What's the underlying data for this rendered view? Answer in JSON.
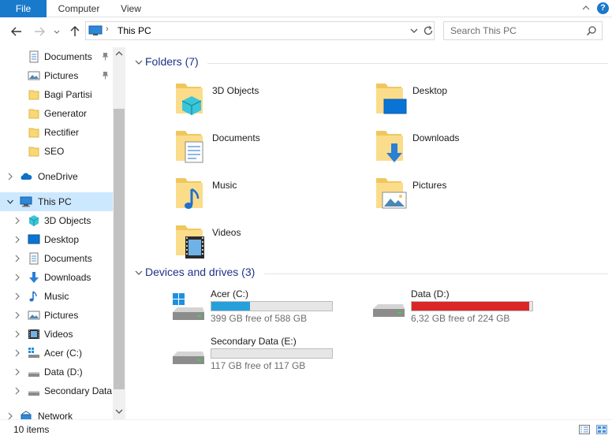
{
  "ribbon": {
    "tabs": [
      "File",
      "Computer",
      "View"
    ],
    "help": "?"
  },
  "address": {
    "separator": "›",
    "path": "This PC"
  },
  "search": {
    "placeholder": "Search This PC"
  },
  "sidebar": {
    "items": [
      {
        "label": "Documents",
        "icon": "documents-icon",
        "pinned": true
      },
      {
        "label": "Pictures",
        "icon": "pictures-icon",
        "pinned": true
      },
      {
        "label": "Bagi Partisi",
        "icon": "folder-icon"
      },
      {
        "label": "Generator",
        "icon": "folder-icon"
      },
      {
        "label": "Rectifier",
        "icon": "folder-icon"
      },
      {
        "label": "SEO",
        "icon": "folder-icon"
      },
      {
        "label": "OneDrive",
        "icon": "onedrive-icon"
      },
      {
        "label": "This PC",
        "icon": "this-pc-icon",
        "selected": true
      },
      {
        "label": "3D Objects",
        "icon": "3d-objects-icon"
      },
      {
        "label": "Desktop",
        "icon": "desktop-icon"
      },
      {
        "label": "Documents",
        "icon": "documents-icon"
      },
      {
        "label": "Downloads",
        "icon": "downloads-icon"
      },
      {
        "label": "Music",
        "icon": "music-icon"
      },
      {
        "label": "Pictures",
        "icon": "pictures-icon"
      },
      {
        "label": "Videos",
        "icon": "videos-icon"
      },
      {
        "label": "Acer (C:)",
        "icon": "system-drive-icon"
      },
      {
        "label": "Data  (D:)",
        "icon": "drive-icon"
      },
      {
        "label": "Secondary Data",
        "icon": "drive-icon"
      },
      {
        "label": "Network",
        "icon": "network-icon"
      }
    ]
  },
  "folders": {
    "heading": "Folders (7)",
    "items": [
      {
        "label": "3D Objects",
        "icon": "3d-objects-folder-icon"
      },
      {
        "label": "Desktop",
        "icon": "desktop-folder-icon"
      },
      {
        "label": "Documents",
        "icon": "documents-folder-icon"
      },
      {
        "label": "Downloads",
        "icon": "downloads-folder-icon"
      },
      {
        "label": "Music",
        "icon": "music-folder-icon"
      },
      {
        "label": "Pictures",
        "icon": "pictures-folder-icon"
      },
      {
        "label": "Videos",
        "icon": "videos-folder-icon"
      }
    ]
  },
  "devices": {
    "heading": "Devices and drives (3)",
    "items": [
      {
        "name": "Acer (C:)",
        "free": "399 GB free of 588 GB",
        "used_fraction": 0.321,
        "bar_color": "#26a0da",
        "icon": "system-drive-icon"
      },
      {
        "name": "Data  (D:)",
        "free": "6,32 GB free of 224 GB",
        "used_fraction": 0.972,
        "bar_color": "#da2626",
        "icon": "drive-icon"
      },
      {
        "name": "Secondary Data (E:)",
        "free": "117 GB free of 117 GB",
        "used_fraction": 0.0,
        "bar_color": "#26a0da",
        "icon": "drive-icon"
      }
    ]
  },
  "status": {
    "count": "10 items"
  },
  "colors": {
    "accent": "#1979ca",
    "selection": "#cce8ff",
    "group_heading": "#1e3287"
  }
}
